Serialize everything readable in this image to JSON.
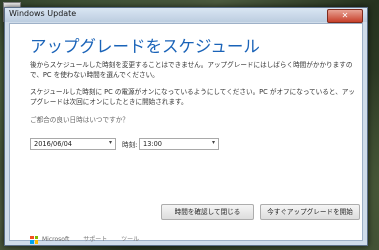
{
  "window": {
    "title": "Windows Update",
    "close_label": "✕"
  },
  "dialog": {
    "heading": "アップグレードをスケジュール",
    "para1": "後からスケジュールした時刻を変更することはできません。アップグレードにはしばらく時間がかかりますので、PC を使わない時間を選んでください。",
    "para2": "スケジュールした時刻に PC の電源がオンになっているようにしてください。PC がオフになっていると、アップグレードは次回にオンにしたときに開始されます。",
    "question": "ご都合の良い日時はいつですか？",
    "date_value": "2016/06/04",
    "time_label": "時刻:",
    "time_value": "13:00",
    "button_check": "時間を確認して閉じる",
    "button_now": "今すぐアップグレードを開始"
  },
  "footer": {
    "brand": "Microsoft",
    "support": "サポート",
    "tool": "ツール"
  }
}
